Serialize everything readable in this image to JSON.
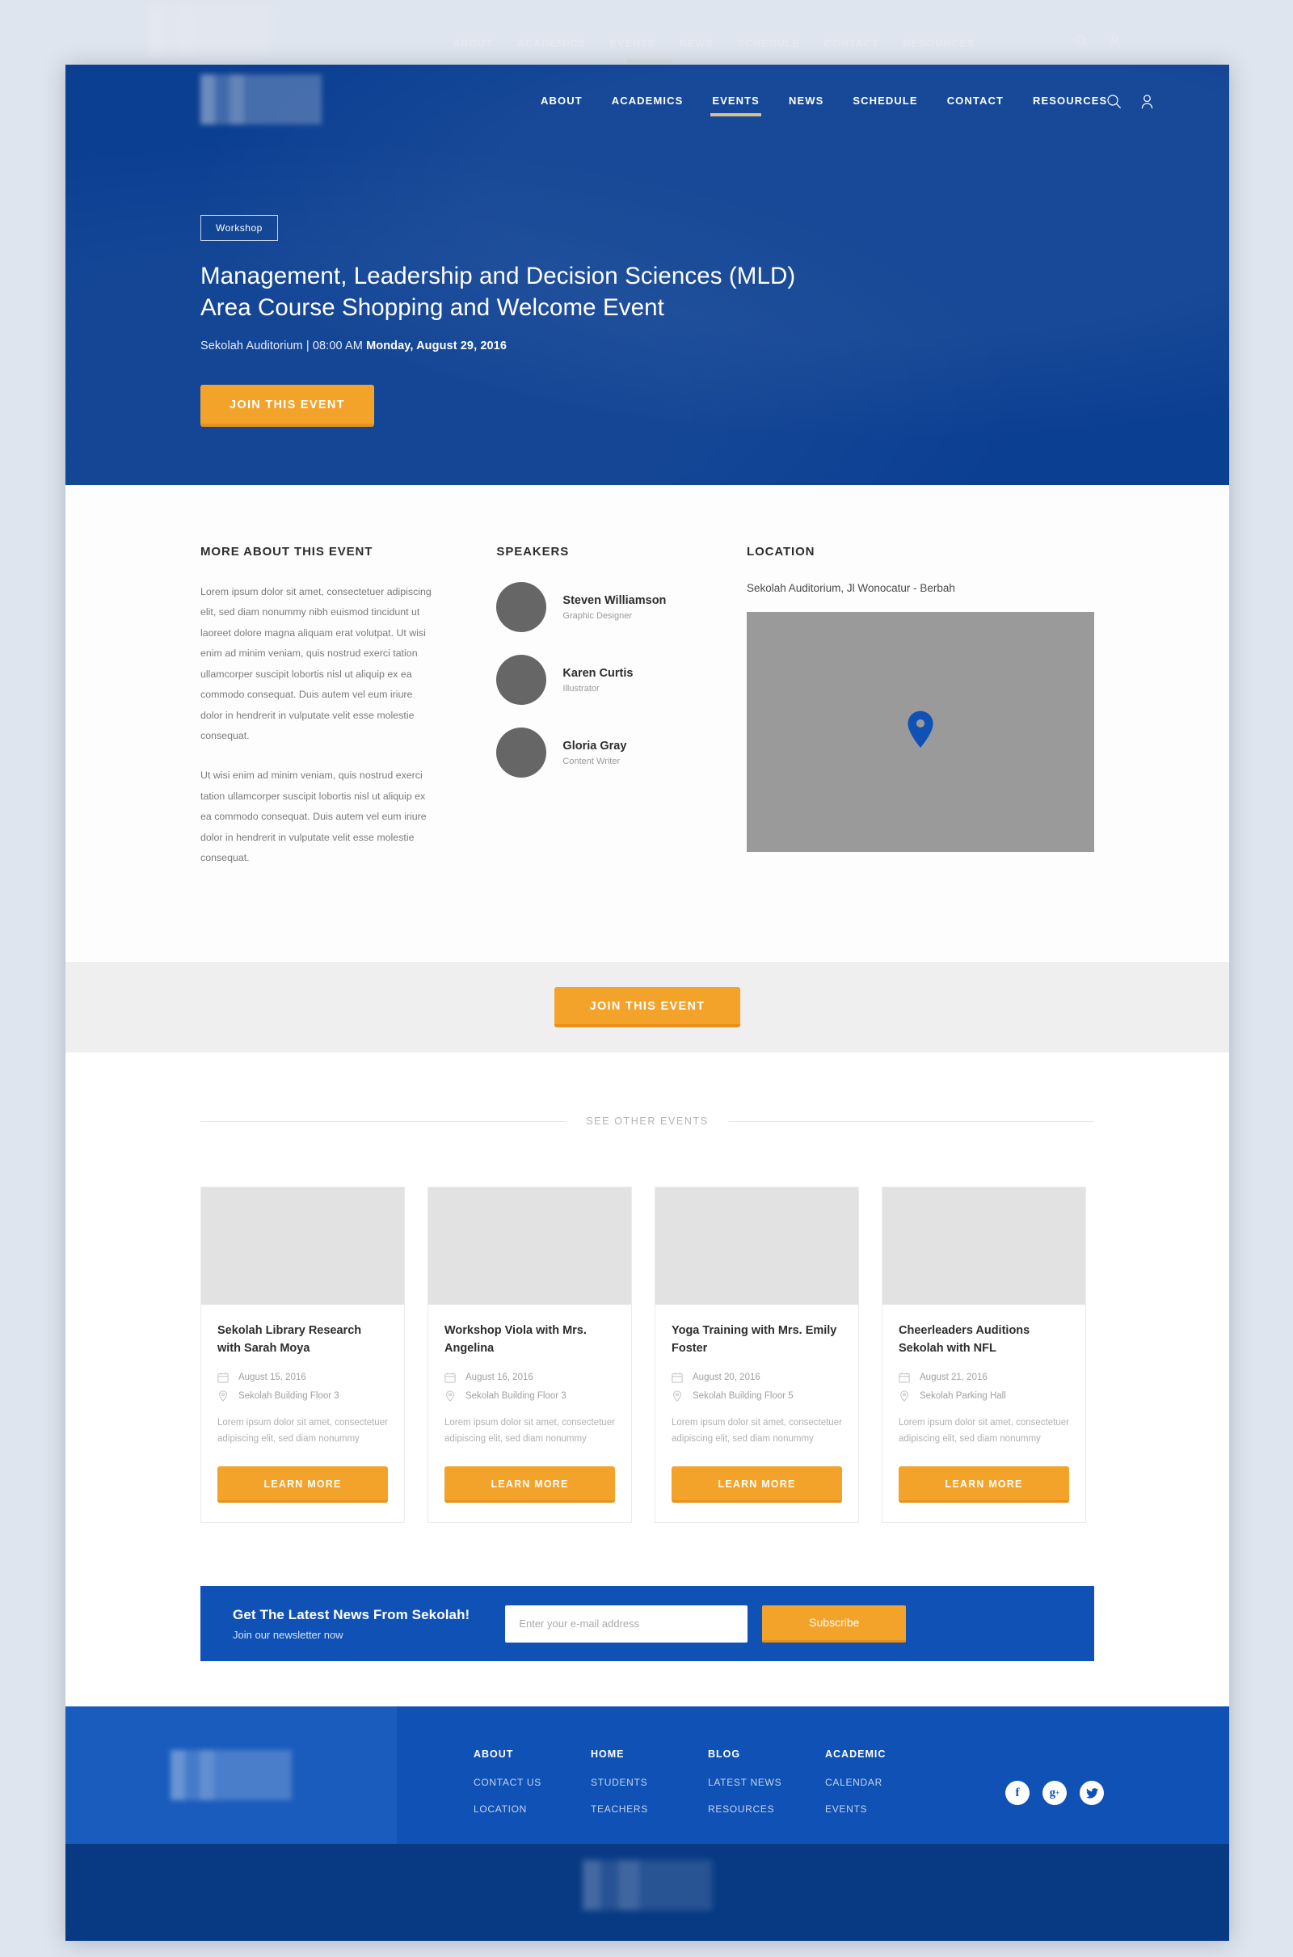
{
  "nav": {
    "items": [
      {
        "label": "ABOUT",
        "active": false
      },
      {
        "label": "ACADEMICS",
        "active": false
      },
      {
        "label": "EVENTS",
        "active": true
      },
      {
        "label": "NEWS",
        "active": false
      },
      {
        "label": "SCHEDULE",
        "active": false
      },
      {
        "label": "CONTACT",
        "active": false
      },
      {
        "label": "RESOURCES",
        "active": false
      }
    ],
    "search_icon": "search-icon",
    "account_icon": "user-icon",
    "accent": "#d8c28c"
  },
  "hero": {
    "badge": "Workshop",
    "title_line1": "Management, Leadership and Decision Sciences (MLD)",
    "title_line2": "Area Course Shopping and Welcome Event",
    "meta_plain": "Sekolah Auditorium | 08:00 AM ",
    "meta_bold": "Monday, August 29, 2016",
    "cta": "JOIN THIS EVENT",
    "bg": "#0b3f92"
  },
  "about": {
    "heading": "MORE ABOUT THIS EVENT",
    "paragraphs": [
      "Lorem ipsum dolor sit amet, consectetuer adipiscing elit, sed diam nonummy nibh euismod tincidunt ut laoreet dolore magna aliquam erat volutpat. Ut wisi enim ad minim veniam, quis nostrud exerci tation ullamcorper suscipit lobortis nisl ut aliquip ex ea commodo consequat. Duis autem vel eum iriure dolor in hendrerit in vulputate velit esse molestie consequat.",
      "Ut wisi enim ad minim veniam, quis nostrud exerci tation ullamcorper suscipit lobortis nisl ut aliquip ex ea commodo consequat. Duis autem vel eum iriure dolor in hendrerit in vulputate velit esse molestie consequat."
    ]
  },
  "speakers": {
    "heading": "SPEAKERS",
    "list": [
      {
        "name": "Steven Williamson",
        "role": "Graphic Designer"
      },
      {
        "name": "Karen Curtis",
        "role": "Illustrator"
      },
      {
        "name": "Gloria Gray",
        "role": "Content Writer"
      }
    ]
  },
  "location": {
    "heading": "LOCATION",
    "address": "Sekolah Auditorium, Jl Wonocatur - Berbah",
    "pin_icon": "map-pin-icon",
    "pin_color": "#0f51b5",
    "map_color": "#9a9a9a"
  },
  "mid_cta": {
    "label": "JOIN THIS EVENT"
  },
  "other_events": {
    "section_label": "SEE OTHER EVENTS",
    "cards": [
      {
        "title": "Sekolah Library Research with Sarah Moya",
        "date": "August 15, 2016",
        "place": "Sekolah Building Floor 3",
        "desc": "Lorem ipsum dolor sit amet, consectetuer adipiscing elit, sed diam nonummy",
        "button": "LEARN MORE"
      },
      {
        "title": "Workshop Viola with Mrs. Angelina",
        "date": "August 16, 2016",
        "place": "Sekolah Building Floor 3",
        "desc": "Lorem ipsum dolor sit amet, consectetuer adipiscing elit, sed diam nonummy",
        "button": "LEARN MORE"
      },
      {
        "title": "Yoga Training with Mrs. Emily Foster",
        "date": "August 20, 2016",
        "place": "Sekolah Building Floor 5",
        "desc": "Lorem ipsum dolor sit amet, consectetuer adipiscing elit, sed diam nonummy",
        "button": "LEARN MORE"
      },
      {
        "title": "Cheerleaders Auditions Sekolah with NFL",
        "date": "August 21, 2016",
        "place": "Sekolah Parking Hall",
        "desc": "Lorem ipsum dolor sit amet, consectetuer adipiscing elit, sed diam nonummy",
        "button": "LEARN MORE"
      }
    ]
  },
  "newsletter": {
    "heading": "Get The Latest News From Sekolah!",
    "subheading": "Join our newsletter now",
    "placeholder": "Enter your e-mail address",
    "input_value": "",
    "button": "Subscribe",
    "bg": "#0f51b5"
  },
  "footer": {
    "columns": [
      {
        "head": "ABOUT",
        "links": [
          "CONTACT US",
          "LOCATION"
        ]
      },
      {
        "head": "HOME",
        "links": [
          "STUDENTS",
          "TEACHERS"
        ]
      },
      {
        "head": "BLOG",
        "links": [
          "LATEST NEWS",
          "RESOURCES"
        ]
      },
      {
        "head": "ACADEMIC",
        "links": [
          "CALENDAR",
          "EVENTS"
        ]
      }
    ],
    "social": [
      {
        "name": "facebook-icon",
        "glyph": "f"
      },
      {
        "name": "google-plus-icon",
        "glyph": "g"
      },
      {
        "name": "twitter-icon",
        "glyph": "t"
      }
    ],
    "bg": "#0f51b5",
    "bottom_bg": "#083a84"
  }
}
